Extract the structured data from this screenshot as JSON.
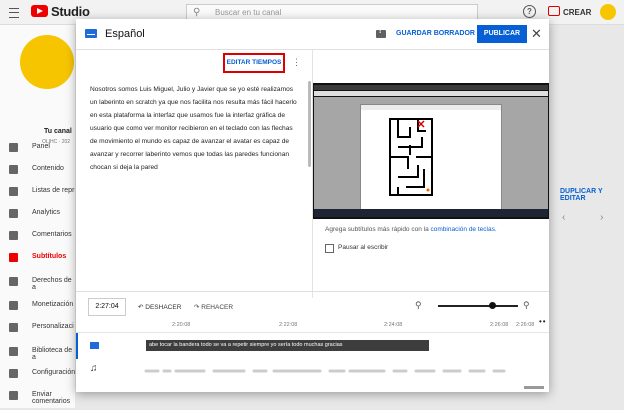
{
  "app": {
    "name": "Studio"
  },
  "search": {
    "placeholder": "Buscar en tu canal"
  },
  "header": {
    "create_label": "CREAR"
  },
  "channel": {
    "name": "Tu canal",
    "subtitle": "OLIHC · 202"
  },
  "sidebar": {
    "items": [
      {
        "label": "Panel",
        "icon": "dashboard-icon",
        "active": false
      },
      {
        "label": "Contenido",
        "icon": "content-icon",
        "active": false
      },
      {
        "label": "Listas de repr",
        "icon": "playlist-icon",
        "active": false
      },
      {
        "label": "Analytics",
        "icon": "analytics-icon",
        "active": false
      },
      {
        "label": "Comentarios",
        "icon": "comments-icon",
        "active": false
      },
      {
        "label": "Subtítulos",
        "icon": "subtitles-icon",
        "active": true
      },
      {
        "label": "Derechos de a",
        "icon": "copyright-icon",
        "active": false
      },
      {
        "label": "Monetización",
        "icon": "monetization-icon",
        "active": false
      },
      {
        "label": "Personalizaci",
        "icon": "customization-icon",
        "active": false
      },
      {
        "label": "Biblioteca de a",
        "icon": "audio-library-icon",
        "active": false
      },
      {
        "label": "Configuración",
        "icon": "settings-icon",
        "active": false
      },
      {
        "label": "Enviar comentarios",
        "icon": "feedback-icon",
        "active": false
      }
    ]
  },
  "background": {
    "duplicate_label": "DUPLICAR Y EDITAR"
  },
  "modal": {
    "title": "Español",
    "save_draft": "GUARDAR BORRADOR",
    "publish": "PUBLICAR",
    "edit_times": "EDITAR TIEMPOS",
    "transcript": "Nosotros somos Luis Miguel, Julio  y Javier que se yo esté realizamos un laberinto en scratch ya que nos facilita nos resulta más fácil hacerlo en esta plataforma la interfaz que usamos fue la interfaz gráfica de usuario que como ver monitor recibieron en el teclado con las flechas de movimiento el mundo es capaz de avanzar el avatar es capaz de avanzar y recorrer laberinto vemos que todas las paredes funcionan chocan si deja la pared",
    "hint_text": "Agrega subtítulos más rápido con la ",
    "hint_link": "combinación de teclas.",
    "pause_label": "Pausar al escribir"
  },
  "timeline": {
    "current_time": "2:27:04",
    "undo_label": "DESHACER",
    "redo_label": "REHACER",
    "ticks": [
      "2:20:08",
      "2:22:08",
      "2:24:08",
      "2:26:08",
      "2:26:08"
    ],
    "caption": "abe tocar la bandera todo se va  a repetir siempre yo sería todo muchas gracias"
  }
}
